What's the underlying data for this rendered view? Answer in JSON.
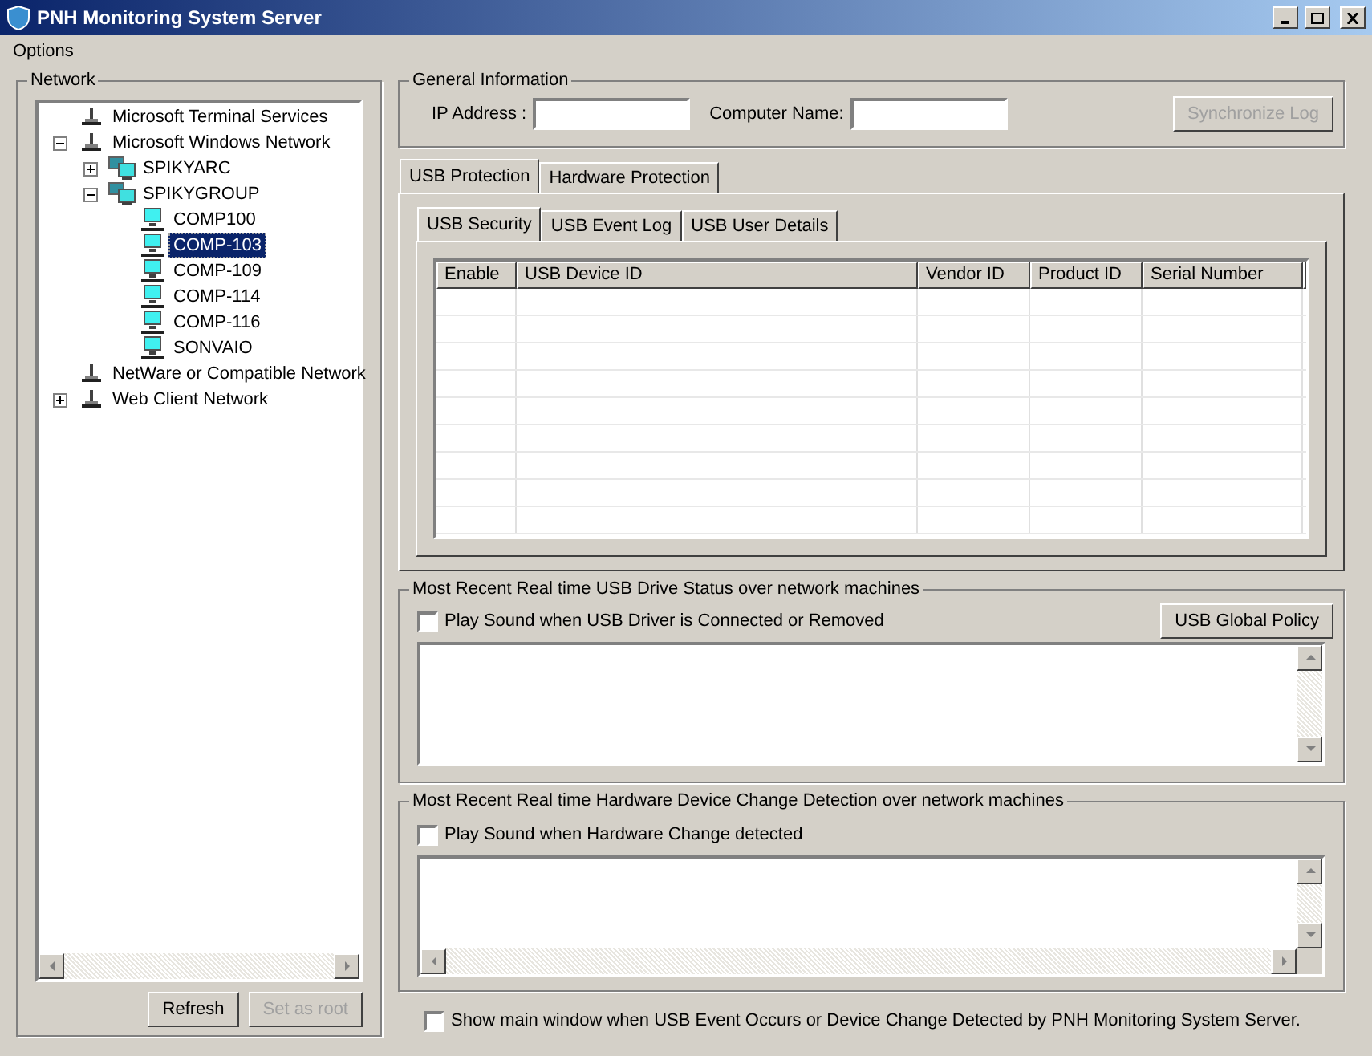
{
  "window": {
    "title": "PNH Monitoring System Server"
  },
  "menu": [
    "Options"
  ],
  "network": {
    "title": "Network",
    "tree": [
      {
        "label": "Microsoft Terminal Services",
        "kind": "network",
        "selected": false
      },
      {
        "label": "Microsoft Windows Network",
        "kind": "network",
        "selected": false,
        "expanded": true,
        "children": [
          {
            "label": "SPIKYARC",
            "kind": "workgroup",
            "selected": false,
            "expanded": false
          },
          {
            "label": "SPIKYGROUP",
            "kind": "workgroup",
            "selected": false,
            "expanded": true,
            "children": [
              {
                "label": "COMP100",
                "kind": "computer",
                "selected": false
              },
              {
                "label": "COMP-103",
                "kind": "computer",
                "selected": true
              },
              {
                "label": "COMP-109",
                "kind": "computer",
                "selected": false
              },
              {
                "label": "COMP-114",
                "kind": "computer",
                "selected": false
              },
              {
                "label": "COMP-116",
                "kind": "computer",
                "selected": false
              },
              {
                "label": "SONVAIO",
                "kind": "computer",
                "selected": false
              }
            ]
          }
        ]
      },
      {
        "label": "NetWare or Compatible Network",
        "kind": "network",
        "selected": false
      },
      {
        "label": "Web Client Network",
        "kind": "network",
        "selected": false,
        "expanded": false
      }
    ],
    "buttons": [
      {
        "label": "Refresh",
        "disabled": false
      },
      {
        "label": "Set as root",
        "disabled": true
      }
    ]
  },
  "general_information": {
    "title": "General Information",
    "ip_label": "IP Address :",
    "computer_name_label": "Computer Name:",
    "sync_button": {
      "label": "Synchronize Log",
      "disabled": true
    }
  },
  "tabs": [
    {
      "label": "USB Protection",
      "selected": true
    },
    {
      "label": "Hardware Protection",
      "selected": false
    }
  ],
  "sub_tabs": [
    {
      "label": "USB Security",
      "selected": true
    },
    {
      "label": "USB Event Log",
      "selected": false
    },
    {
      "label": "USB User Details",
      "selected": false
    }
  ],
  "table": {
    "columns": [
      "Enable",
      "USB Device ID",
      "Vendor ID",
      "Product ID",
      "Serial Number"
    ]
  },
  "usb_status": {
    "title": "Most Recent Real time USB Drive Status over network machines",
    "checkbox": {
      "label": "Play Sound when USB Driver is Connected or Removed",
      "checked": false
    },
    "button": "USB Global Policy"
  },
  "hardware_status": {
    "title": "Most Recent Real time Hardware Device Change Detection over network machines",
    "checkbox": {
      "label": "Play Sound when Hardware Change detected",
      "checked": false
    }
  },
  "footer_checkbox": {
    "label": "Show main window when USB Event Occurs or Device Change Detected by PNH Monitoring System Server.",
    "checked": false
  }
}
